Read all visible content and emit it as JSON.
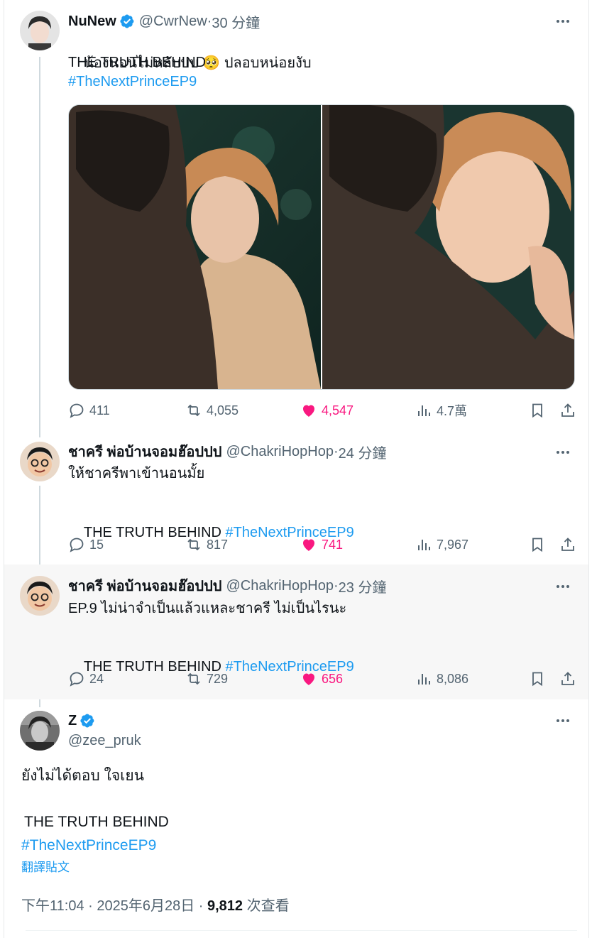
{
  "tweets": [
    {
      "name": "NuNew",
      "handle": "@CwrNew",
      "time": "30 分鐘",
      "line1_a": "น้องนอนไม่หลับบบ",
      "line1_emoji": "🥺",
      "line1_b": "ปลอบหน่อยงับ",
      "line2": "THE TRUTH BEHIND",
      "hashtag": "#TheNextPrinceEP9",
      "replies": "411",
      "retweets": "4,055",
      "likes": "4,547",
      "views": "4.7萬"
    },
    {
      "name": "ชาครี พ่อบ้านจอมฮ๊อปปป",
      "handle": "@ChakriHopHop",
      "time": "24 分鐘",
      "line1": "ให้ชาครีพาเข้านอนมั้ย",
      "line2": "THE TRUTH BEHIND",
      "hashtag": "#TheNextPrinceEP9",
      "replies": "15",
      "retweets": "817",
      "likes": "741",
      "views": "7,967"
    },
    {
      "name": "ชาครี พ่อบ้านจอมฮ๊อปปป",
      "handle": "@ChakriHopHop",
      "time": "23 分鐘",
      "line1": "EP.9 ไม่น่าจำเป็นแล้วแหละชาครี ไม่เป็นไรนะ",
      "line2": "THE TRUTH BEHIND",
      "hashtag": "#TheNextPrinceEP9",
      "replies": "24",
      "retweets": "729",
      "likes": "656",
      "views": "8,086"
    }
  ],
  "main_tweet": {
    "name": "Z",
    "handle": "@zee_pruk",
    "line1": "ยังไม่ได้ตอบ ใจเยน",
    "line2": "THE TRUTH BEHIND",
    "hashtag": "#TheNextPrinceEP9",
    "translate": "翻譯貼文",
    "timestamp": "下午11:04 · 2025年6月28日 · ",
    "views_count": "9,812",
    "views_label": " 次查看"
  },
  "separator": " · ",
  "colors": {
    "accent": "#1d9bf0",
    "like": "#f91880",
    "secondary_text": "#536471",
    "highlight_bg": "#f7f7f7"
  },
  "icons": [
    "verified-badge-icon",
    "more-icon",
    "reply-icon",
    "retweet-icon",
    "like-icon",
    "views-icon",
    "bookmark-icon",
    "share-icon"
  ]
}
